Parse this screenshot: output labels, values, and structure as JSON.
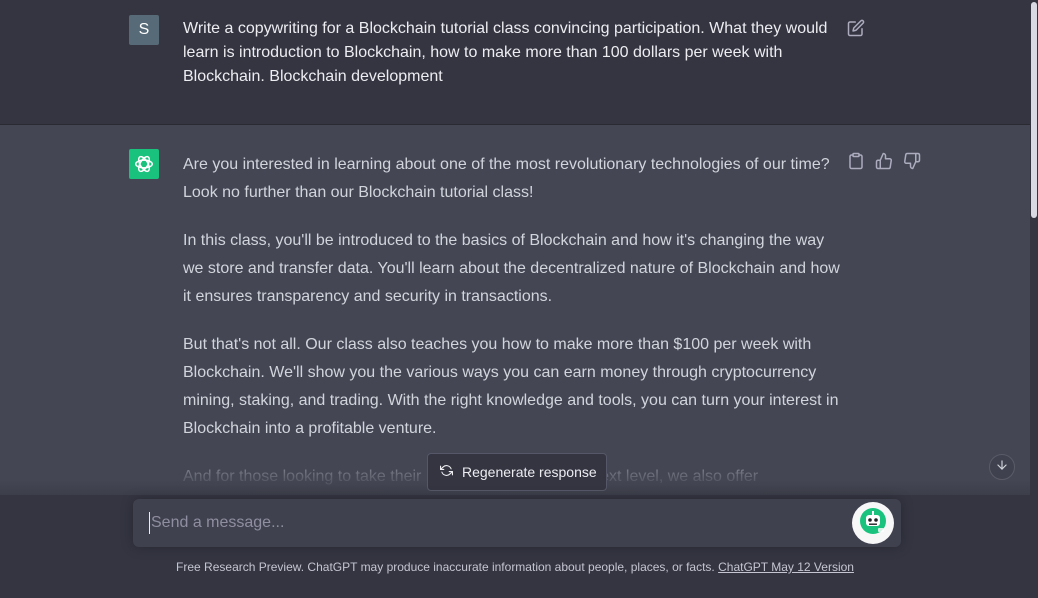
{
  "user": {
    "avatar_letter": "S",
    "message": "Write a copywriting for a Blockchain tutorial class convincing participation. What they would learn is introduction to Blockchain, how to make more than 100 dollars per week with Blockchain. Blockchain development"
  },
  "assistant": {
    "paragraphs": [
      "Are you interested in learning about one of the most revolutionary technologies of our time? Look no further than our Blockchain tutorial class!",
      "In this class, you'll be introduced to the basics of Blockchain and how it's changing the way we store and transfer data. You'll learn about the decentralized nature of Blockchain and how it ensures transparency and security in transactions.",
      "But that's not all. Our class also teaches you how to make more than $100 per week with Blockchain. We'll show you the various ways you can earn money through cryptocurrency mining, staking, and trading. With the right knowledge and tools, you can turn your interest in Blockchain into a profitable venture.",
      "And for those looking to take their Blockchain skills to the next level, we also offer"
    ]
  },
  "regenerate_label": "Regenerate response",
  "input": {
    "placeholder": "Send a message..."
  },
  "footer": {
    "text": "Free Research Preview. ChatGPT may produce inaccurate information about people, places, or facts.",
    "link": "ChatGPT May 12 Version"
  },
  "icons": {
    "edit": "edit-icon",
    "copy": "clipboard-icon",
    "like": "thumbs-up-icon",
    "dislike": "thumbs-down-icon",
    "regenerate": "refresh-icon",
    "scroll": "arrow-down-icon",
    "bot": "robot-icon"
  },
  "colors": {
    "accent": "#19c37d",
    "user_bg": "#343541",
    "assistant_bg": "#444654"
  }
}
